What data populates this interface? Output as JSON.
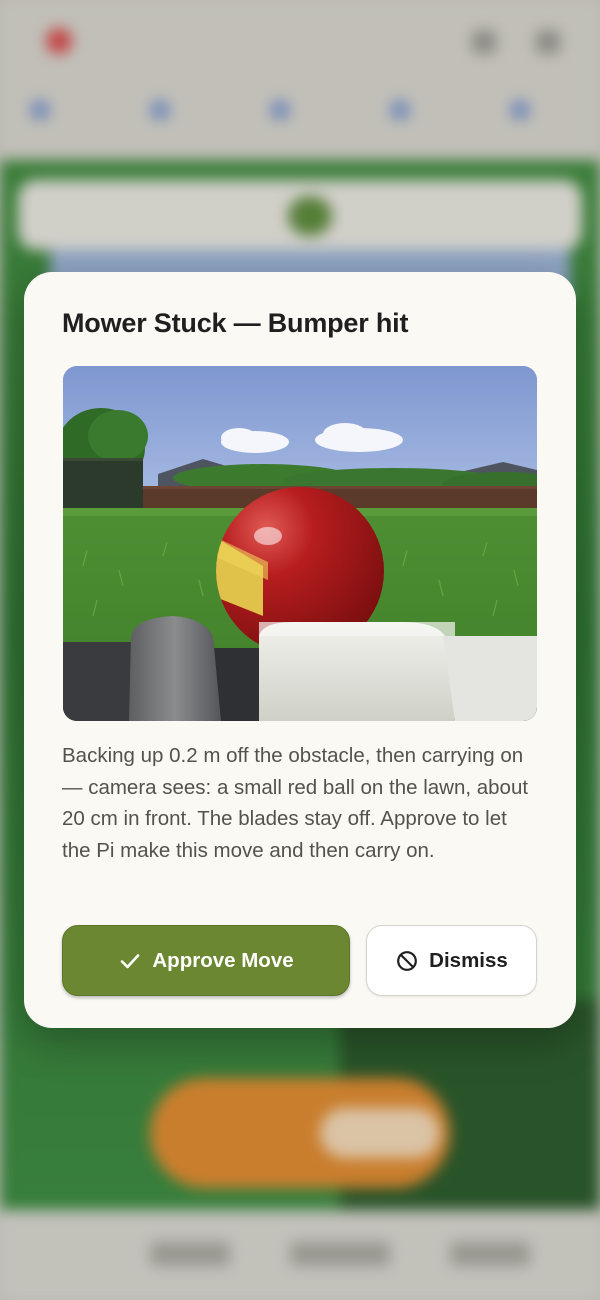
{
  "modal": {
    "title": "Mower Stuck — Bumper hit",
    "message": "Backing up 0.2 m off the obstacle, then carrying on — camera sees: a small red ball on the lawn, about 20 cm in front. The blades stay off. Approve to let the Pi make this move and then carry on.",
    "approve_label": "Approve Move",
    "dismiss_label": "Dismiss",
    "approve_icon": "check-icon",
    "dismiss_icon": "prohibit-icon",
    "approve_color": "#6b8731"
  }
}
